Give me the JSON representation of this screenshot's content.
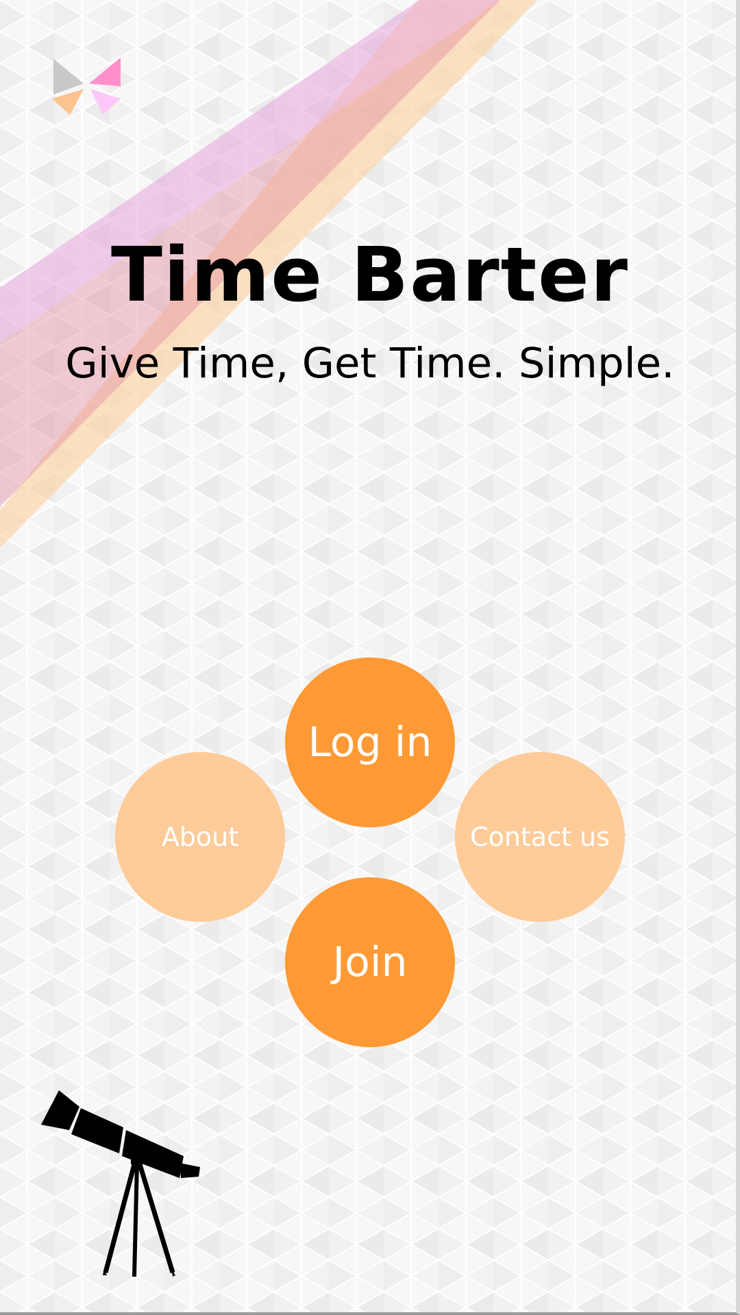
{
  "app": {
    "title": "Time Barter",
    "tagline": "Give Time, Get Time. Simple."
  },
  "actions": {
    "login_label": "Log in",
    "join_label": "Join",
    "about_label": "About",
    "contact_label": "Contact us"
  },
  "icons": {
    "logo": "pinwheel-logo-icon",
    "decoration": "telescope-icon"
  },
  "colors": {
    "primary_button": "#fd9a35",
    "secondary_button": "#fecb99",
    "stripe_pink": "#e7a6de",
    "stripe_red": "#e58b9d",
    "stripe_orange": "#fcd3a5"
  }
}
